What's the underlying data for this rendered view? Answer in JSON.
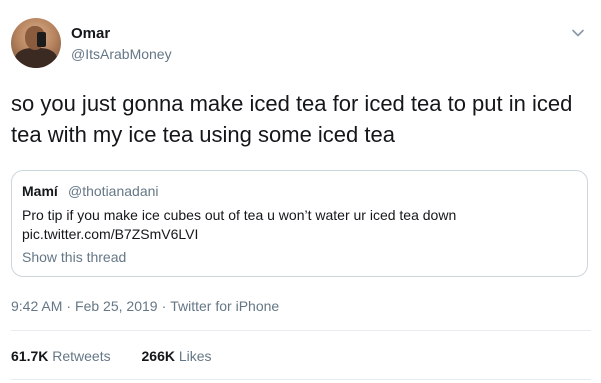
{
  "tweet": {
    "author": {
      "name": "Omar",
      "handle": "@ItsArabMoney"
    },
    "text": "so you just gonna make iced tea for iced tea to put in iced tea with my ice tea using some iced tea",
    "quote": {
      "name": "Mamí",
      "handle": "@thotianadani",
      "text": "Pro tip if you make ice cubes out of tea u won’t water ur iced tea down",
      "link": "pic.twitter.com/B7ZSmV6LVI",
      "show_thread": "Show this thread"
    },
    "meta": {
      "time": "9:42 AM",
      "date": "Feb 25, 2019",
      "source": "Twitter for iPhone",
      "separator": "·"
    },
    "stats": {
      "retweets_count": "61.7K",
      "retweets_label": "Retweets",
      "likes_count": "266K",
      "likes_label": "Likes"
    }
  },
  "icons": {
    "menu": "chevron-down-icon",
    "avatar": "avatar"
  },
  "colors": {
    "text": "#14171a",
    "secondary": "#657786",
    "border": "#ccd6dd"
  }
}
